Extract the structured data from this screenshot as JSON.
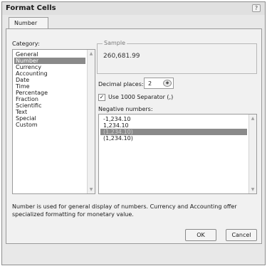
{
  "window": {
    "title": "Format Cells",
    "help_glyph": "?"
  },
  "tabs": [
    {
      "label": "Number"
    }
  ],
  "category": {
    "label": "Category:",
    "items": [
      "General",
      "Number",
      "Currency",
      "Accounting",
      "Date",
      "Time",
      "Percentage",
      "Fraction",
      "Scientific",
      "Text",
      "Special",
      "Custom"
    ],
    "selected": "Number"
  },
  "sample": {
    "legend": "Sample",
    "value": "260,681.99"
  },
  "decimal_places": {
    "label": "Decimal places:",
    "value": "2"
  },
  "separator": {
    "label": "Use 1000 Separator (,)",
    "checked": true,
    "check_glyph": "✓"
  },
  "negative_numbers": {
    "label": "Negative numbers:",
    "items": [
      "-1,234.10",
      "1,234.10",
      "(1,234.10)",
      "(1,234.10)"
    ],
    "selected_index": 2
  },
  "description": "Number is used for general display of numbers. Currency and Accounting offer specialized formatting for monetary value.",
  "buttons": {
    "ok": "OK",
    "cancel": "Cancel"
  },
  "icons": {
    "scroll_up": "▲",
    "scroll_down": "▼",
    "spinner": "◆"
  },
  "colors": {
    "selection": "#8a8a8a",
    "dialog_bg": "#e8e8e8",
    "panel_bg": "#f1f1f1"
  }
}
